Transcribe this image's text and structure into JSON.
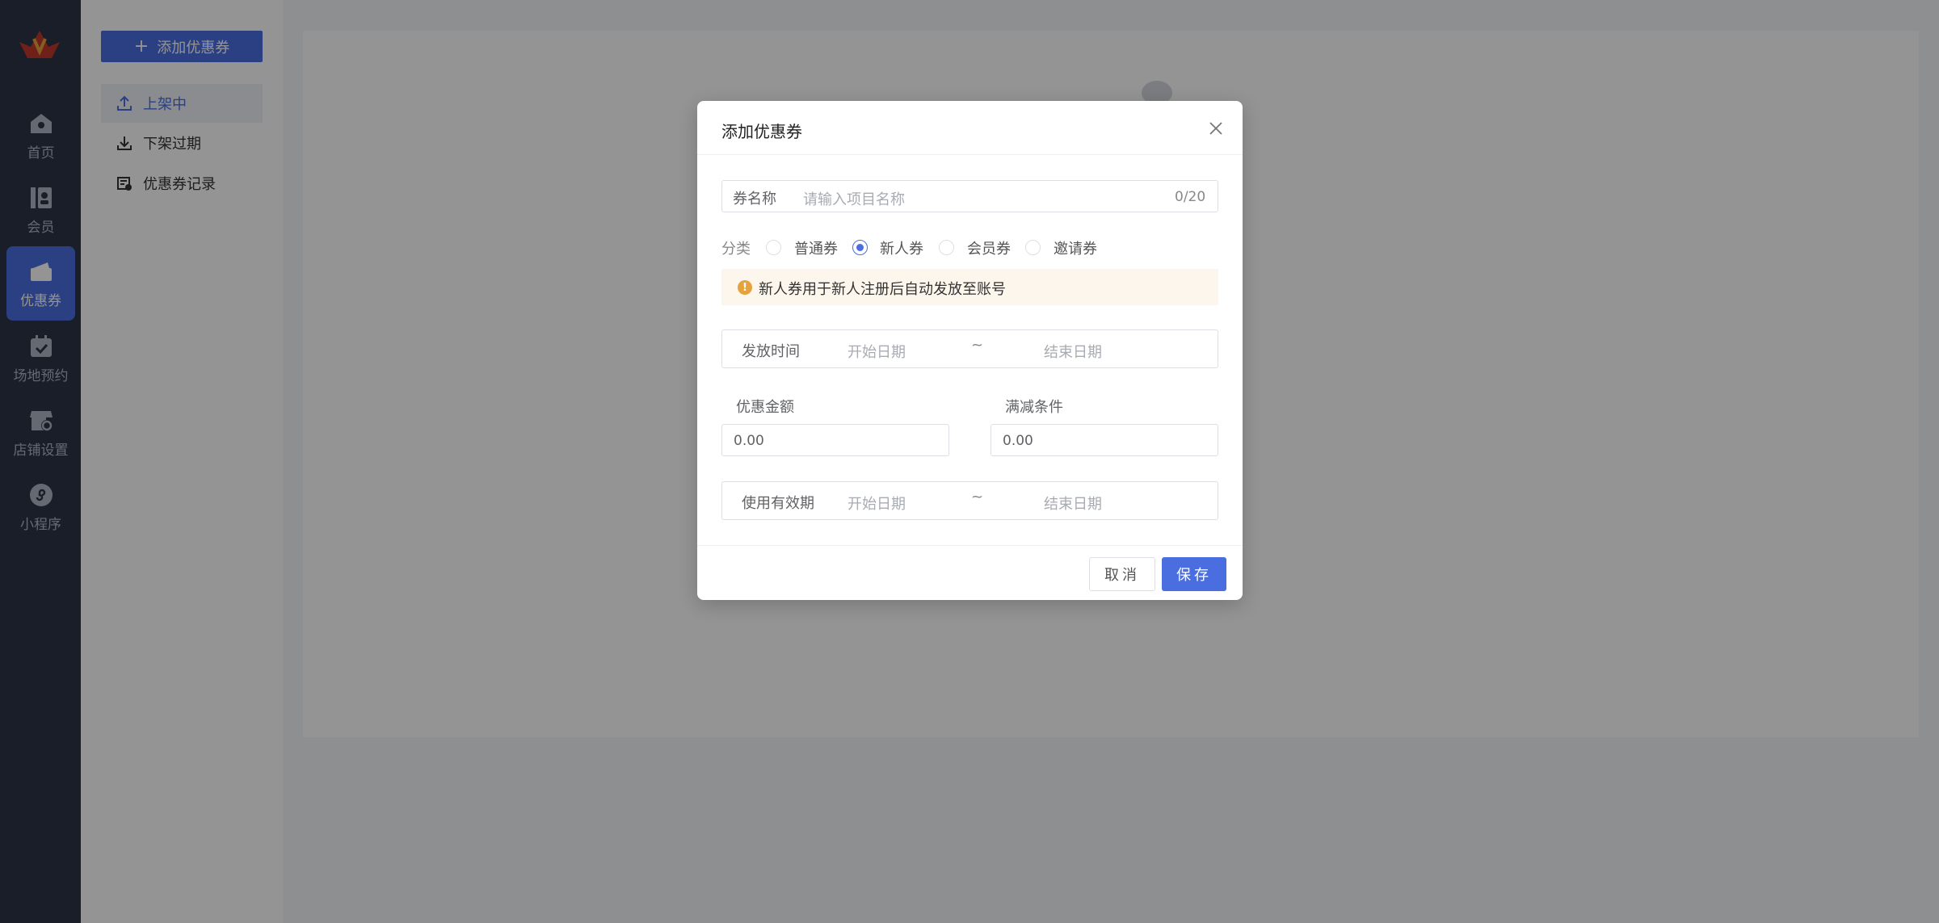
{
  "nav": {
    "items": [
      {
        "label": "首页",
        "icon": "home-icon"
      },
      {
        "label": "会员",
        "icon": "member-icon"
      },
      {
        "label": "优惠券",
        "icon": "coupon-icon",
        "active": true
      },
      {
        "label": "场地预约",
        "icon": "calendar-check-icon"
      },
      {
        "label": "店铺设置",
        "icon": "store-settings-icon"
      },
      {
        "label": "小程序",
        "icon": "mini-program-icon"
      }
    ]
  },
  "subnav": {
    "add_label": "添加优惠券",
    "items": [
      {
        "label": "上架中",
        "icon": "upload-icon",
        "active": true
      },
      {
        "label": "下架过期",
        "icon": "download-icon"
      },
      {
        "label": "优惠券记录",
        "icon": "record-icon"
      }
    ]
  },
  "dialog": {
    "title": "添加优惠券",
    "name_field": {
      "label": "券名称",
      "placeholder": "请输入项目名称",
      "counter": "0/20"
    },
    "category": {
      "label": "分类",
      "options": [
        "普通券",
        "新人券",
        "会员券",
        "邀请券"
      ],
      "selected": "新人券"
    },
    "notice": "新人券用于新人注册后自动发放至账号",
    "issue_time": {
      "label": "发放时间",
      "start_placeholder": "开始日期",
      "separator": "~",
      "end_placeholder": "结束日期"
    },
    "discount_amount": {
      "label": "优惠金额",
      "value": "0.00"
    },
    "threshold": {
      "label": "满减条件",
      "value": "0.00"
    },
    "valid_period": {
      "label": "使用有效期",
      "start_placeholder": "开始日期",
      "separator": "~",
      "end_placeholder": "结束日期"
    },
    "cancel_label": "取消",
    "save_label": "保存"
  },
  "colors": {
    "primary": "#4a6ee0",
    "nav_bg": "#2b3548",
    "notice_bg": "#fdf6ec",
    "warning": "#e6a23c"
  }
}
